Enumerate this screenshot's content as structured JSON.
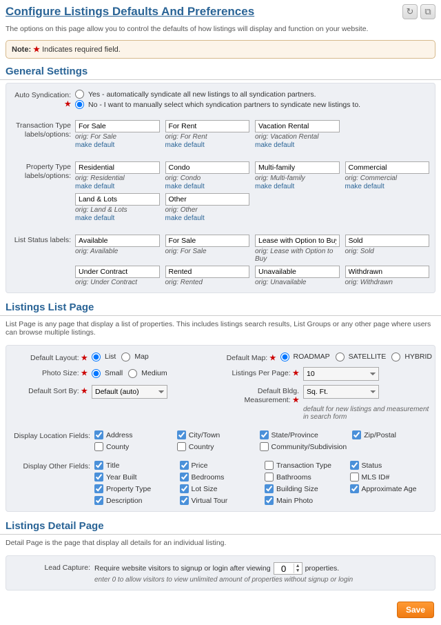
{
  "page": {
    "title": "Configure Listings Defaults And Preferences",
    "intro": "The options on this page allow you to control the defaults of how listings will display and function on your website.",
    "note_label": "Note:",
    "note_text": "Indicates required field."
  },
  "icons": {
    "refresh": "↻",
    "copy": "⧉"
  },
  "sections": {
    "general": "General Settings",
    "list": "Listings List Page",
    "list_desc": "List Page is any page that display a list of properties. This includes listings search results, List Groups or any other page where users can browse multiple listings.",
    "detail": "Listings Detail Page",
    "detail_desc": "Detail Page is the page that display all details for an individual listing."
  },
  "general": {
    "auto_syndication_label": "Auto Syndication:",
    "auto_opt_yes": "Yes - automatically syndicate all new listings to all syndication partners.",
    "auto_opt_no": "No - I want to manually select which syndication partners to syndicate new listings to.",
    "txn_label": "Transaction Type labels/options:",
    "prop_label": "Property Type labels/options:",
    "status_label": "List Status labels:",
    "make_default": "make default",
    "txn": [
      {
        "val": "For Sale",
        "orig": "orig: For Sale"
      },
      {
        "val": "For Rent",
        "orig": "orig: For Rent"
      },
      {
        "val": "Vacation Rental",
        "orig": "orig: Vacation Rental"
      }
    ],
    "prop": [
      {
        "val": "Residential",
        "orig": "orig: Residential"
      },
      {
        "val": "Condo",
        "orig": "orig: Condo"
      },
      {
        "val": "Multi-family",
        "orig": "orig: Multi-family"
      },
      {
        "val": "Commercial",
        "orig": "orig: Commercial"
      },
      {
        "val": "Land & Lots",
        "orig": "orig: Land & Lots"
      },
      {
        "val": "Other",
        "orig": "orig: Other"
      }
    ],
    "status": [
      {
        "val": "Available",
        "orig": "orig: Available"
      },
      {
        "val": "For Sale",
        "orig": "orig: For Sale"
      },
      {
        "val": "Lease with Option to Buy",
        "orig": "orig: Lease with Option to Buy"
      },
      {
        "val": "Sold",
        "orig": "orig: Sold"
      },
      {
        "val": "Under Contract",
        "orig": "orig: Under Contract"
      },
      {
        "val": "Rented",
        "orig": "orig: Rented"
      },
      {
        "val": "Unavailable",
        "orig": "orig: Unavailable"
      },
      {
        "val": "Withdrawn",
        "orig": "orig: Withdrawn"
      }
    ]
  },
  "list": {
    "default_layout_label": "Default Layout:",
    "layout_list": "List",
    "layout_map": "Map",
    "default_map_label": "Default Map:",
    "map_road": "ROADMAP",
    "map_sat": "SATELLITE",
    "map_hyb": "HYBRID",
    "photo_size_label": "Photo Size:",
    "size_small": "Small",
    "size_med": "Medium",
    "lpp_label": "Listings Per Page:",
    "lpp_value": "10",
    "sort_label": "Default Sort By:",
    "sort_value": "Default (auto)",
    "bldg_label": "Default Bldg. Measurement:",
    "bldg_value": "Sq. Ft.",
    "bldg_hint": "default for new listings and measurement in search form",
    "disp_loc_label": "Display Location Fields:",
    "loc": [
      {
        "t": "Address",
        "c": true
      },
      {
        "t": "City/Town",
        "c": true
      },
      {
        "t": "State/Province",
        "c": true
      },
      {
        "t": "Zip/Postal",
        "c": true
      },
      {
        "t": "County",
        "c": false
      },
      {
        "t": "Country",
        "c": false
      },
      {
        "t": "Community/Subdivision",
        "c": false
      }
    ],
    "disp_other_label": "Display Other Fields:",
    "other": [
      {
        "t": "Title",
        "c": true
      },
      {
        "t": "Price",
        "c": true
      },
      {
        "t": "Transaction Type",
        "c": false
      },
      {
        "t": "Status",
        "c": true
      },
      {
        "t": "Year Built",
        "c": true
      },
      {
        "t": "Bedrooms",
        "c": true
      },
      {
        "t": "Bathrooms",
        "c": false
      },
      {
        "t": "MLS ID#",
        "c": false
      },
      {
        "t": "Property Type",
        "c": true
      },
      {
        "t": "Lot Size",
        "c": true
      },
      {
        "t": "Building Size",
        "c": true
      },
      {
        "t": "Approximate Age",
        "c": true
      },
      {
        "t": "Description",
        "c": true
      },
      {
        "t": "Virtual Tour",
        "c": true
      },
      {
        "t": "Main Photo",
        "c": true
      }
    ]
  },
  "detail": {
    "lead_label": "Lead Capture:",
    "lead_before": "Require website visitors to signup or login after viewing",
    "lead_value": "0",
    "lead_after": "properties.",
    "lead_hint": "enter 0 to allow visitors to view unlimited amount of properties without signup or login"
  },
  "save": "Save"
}
